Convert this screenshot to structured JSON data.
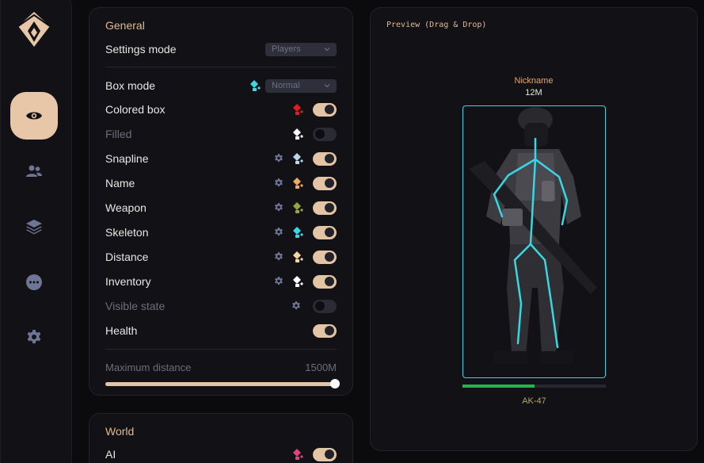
{
  "sidebar": {
    "items": [
      {
        "icon": "eye-icon",
        "active": true
      },
      {
        "icon": "users-icon",
        "active": false
      },
      {
        "icon": "layers-icon",
        "active": false
      },
      {
        "icon": "more-icon",
        "active": false
      },
      {
        "icon": "settings-icon",
        "active": false
      }
    ]
  },
  "general": {
    "title": "General",
    "settings_mode": {
      "label": "Settings mode",
      "value": "Players"
    },
    "box_mode": {
      "label": "Box mode",
      "value": "Normal",
      "color": "#39d6e4"
    },
    "rows": [
      {
        "label": "Colored box",
        "enabled": true,
        "gear": false,
        "color": "#e01d1d"
      },
      {
        "label": "Filled",
        "enabled": false,
        "gear": false,
        "color": "#ffffff",
        "disabled": true
      },
      {
        "label": "Snapline",
        "enabled": true,
        "gear": true,
        "color": "#b9d6e6"
      },
      {
        "label": "Name",
        "enabled": true,
        "gear": true,
        "color": "#f0a860"
      },
      {
        "label": "Weapon",
        "enabled": true,
        "gear": true,
        "color": "#9aa23a"
      },
      {
        "label": "Skeleton",
        "enabled": true,
        "gear": true,
        "color": "#39d6e4"
      },
      {
        "label": "Distance",
        "enabled": true,
        "gear": true,
        "color": "#f5d7a4"
      },
      {
        "label": "Inventory",
        "enabled": true,
        "gear": true,
        "color": "#ffffff"
      },
      {
        "label": "Visible state",
        "enabled": false,
        "gear": true,
        "color": null,
        "disabled": true
      },
      {
        "label": "Health",
        "enabled": true,
        "gear": false,
        "color": null
      }
    ],
    "max_distance": {
      "label": "Maximum distance",
      "value": "1500M",
      "fraction": 1.0
    }
  },
  "world": {
    "title": "World",
    "rows": [
      {
        "label": "AI",
        "enabled": true,
        "color": "#e0437a"
      }
    ]
  },
  "preview": {
    "title": "Preview (Drag & Drop)",
    "nickname": "Nickname",
    "distance": "12M",
    "weapon": "AK-47",
    "health_fraction": 0.5,
    "box_color": "#39d6e4",
    "health_color": "#27b24a"
  },
  "colors": {
    "accent": "#e2b88f",
    "toggle_on": "#e3c4a4",
    "panel": "#121216",
    "background": "#0b0b0e"
  }
}
